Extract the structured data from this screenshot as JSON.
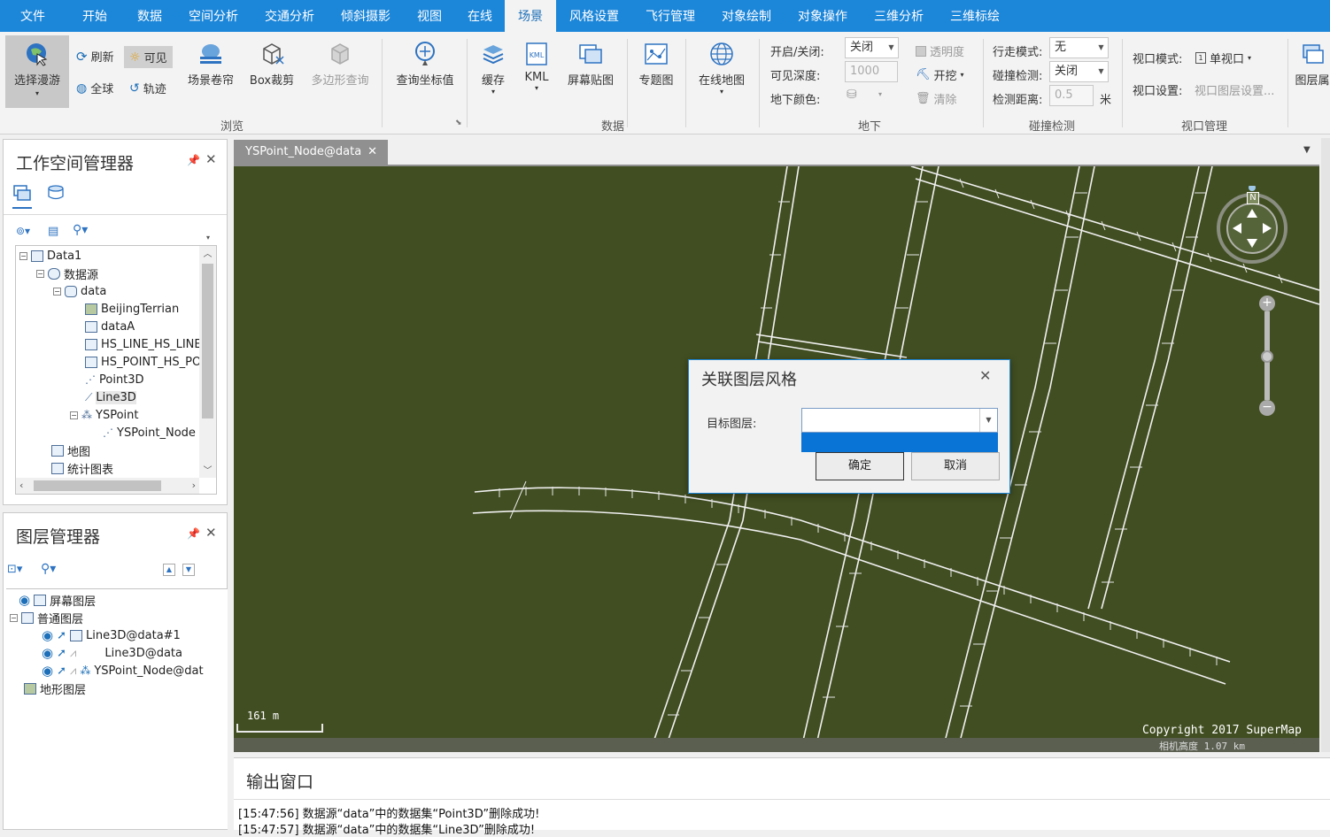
{
  "menubar": {
    "items": [
      "文件",
      "开始",
      "数据",
      "空间分析",
      "交通分析",
      "倾斜摄影",
      "视图",
      "在线",
      "场景",
      "风格设置",
      "飞行管理",
      "对象绘制",
      "对象操作",
      "三维分析",
      "三维标绘"
    ],
    "active": "场景"
  },
  "ribbon": {
    "browse": {
      "select_roam": "选择漫游",
      "refresh": "刷新",
      "visible": "可见",
      "full_globe": "全球",
      "track": "轨迹",
      "scene_curtain": "场景卷帘",
      "box_clip": "Box裁剪",
      "polygon_query": "多边形查询",
      "query_coord": "查询坐标值",
      "group_label": "浏览"
    },
    "data": {
      "cache": "缓存",
      "kml": "KML",
      "screen_map": "屏幕贴图",
      "thematic": "专题图",
      "online_map": "在线地图",
      "group_label": "数据"
    },
    "underground": {
      "on_off_label": "开启/关闭:",
      "on_off_value": "关闭",
      "depth_label": "可见深度:",
      "depth_value": "1000",
      "color_label": "地下颜色:",
      "transparency": "透明度",
      "excavate": "开挖",
      "clear": "清除",
      "group_label": "地下"
    },
    "collision": {
      "walk_mode_label": "行走模式:",
      "walk_mode_value": "无",
      "collision_label": "碰撞检测:",
      "collision_value": "关闭",
      "distance_label": "检测距离:",
      "distance_value": "0.5",
      "distance_unit": "米",
      "group_label": "碰撞检测"
    },
    "viewport": {
      "mode_label": "视口模式:",
      "mode_value": "单视口",
      "settings_label": "视口设置:",
      "settings_value": "视口图层设置...",
      "group_label": "视口管理",
      "layer_btn": "图层属"
    }
  },
  "workspace": {
    "title": "工作空间管理器",
    "tree": [
      {
        "label": "Data1"
      },
      {
        "label": "数据源"
      },
      {
        "label": "data"
      },
      {
        "label": "BeijingTerrian"
      },
      {
        "label": "dataA"
      },
      {
        "label": "HS_LINE_HS_LINE"
      },
      {
        "label": "HS_POINT_HS_PO"
      },
      {
        "label": "Point3D"
      },
      {
        "label": "Line3D"
      },
      {
        "label": "YSPoint"
      },
      {
        "label": "YSPoint_Node"
      },
      {
        "label": "地图"
      },
      {
        "label": "统计图表"
      }
    ]
  },
  "layers": {
    "title": "图层管理器",
    "tree": [
      {
        "label": "屏幕图层"
      },
      {
        "label": "普通图层"
      },
      {
        "label": "Line3D@data#1"
      },
      {
        "label": "Line3D@data"
      },
      {
        "label": "YSPoint_Node@dat"
      },
      {
        "label": "地形图层"
      }
    ]
  },
  "document_tab": {
    "title": "YSPoint_Node@data"
  },
  "map": {
    "scale_text": "161 m",
    "copyright": "Copyright 2017 SuperMap",
    "camera_height": "相机高度 1.07 km",
    "compass_letter": "N"
  },
  "dialog": {
    "title": "关联图层风格",
    "target_label": "目标图层:",
    "target_value": "",
    "ok": "确定",
    "cancel": "取消"
  },
  "output": {
    "title": "输出窗口",
    "lines": [
      "[15:47:56] 数据源“data”中的数据集“Point3D”删除成功!",
      "[15:47:57] 数据源“data”中的数据集“Line3D”删除成功!"
    ]
  },
  "colors": {
    "accent": "#1c86d9",
    "map_bg": "#414e22",
    "selection": "#0a74d6"
  }
}
